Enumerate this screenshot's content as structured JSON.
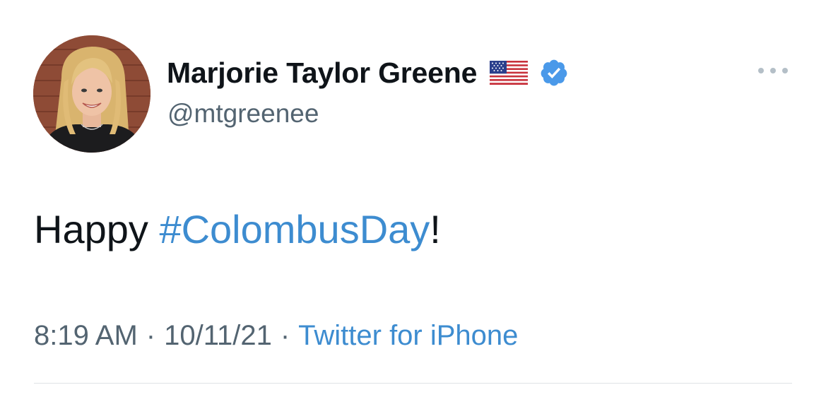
{
  "author": {
    "display_name": "Marjorie Taylor Greene",
    "handle": "@mtgreenee",
    "flag_icon": "us-flag-icon",
    "verified_icon": "verified-badge-icon",
    "verified_color": "#4a99e9"
  },
  "tweet": {
    "text_prefix": "Happy ",
    "hashtag": "#ColombusDay",
    "text_suffix": "!",
    "hashtag_color": "#3d8cd0"
  },
  "meta": {
    "time": "8:19 AM",
    "separator": "·",
    "date": "10/11/21",
    "source": "Twitter for iPhone"
  },
  "menu": {
    "more_icon": "more-options-icon"
  }
}
